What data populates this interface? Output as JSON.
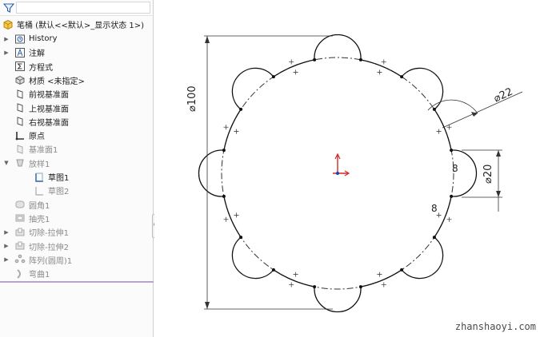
{
  "feature_tree": {
    "root": "笔桶  (默认<<默认>_显示状态 1>)",
    "items": [
      {
        "label": "History",
        "dim": false,
        "expand": "▶"
      },
      {
        "label": "注解",
        "dim": false,
        "expand": "▶"
      },
      {
        "label": "方程式",
        "dim": false,
        "expand": ""
      },
      {
        "label": "材质 <未指定>",
        "dim": false,
        "expand": ""
      },
      {
        "label": "前视基准面",
        "dim": false,
        "expand": ""
      },
      {
        "label": "上视基准面",
        "dim": false,
        "expand": ""
      },
      {
        "label": "右视基准面",
        "dim": false,
        "expand": ""
      },
      {
        "label": "原点",
        "dim": false,
        "expand": ""
      },
      {
        "label": "基准面1",
        "dim": true,
        "expand": ""
      },
      {
        "label": "放样1",
        "dim": true,
        "expand": "▼"
      },
      {
        "label": "草图1",
        "dim": false,
        "expand": ""
      },
      {
        "label": "草图2",
        "dim": true,
        "expand": ""
      },
      {
        "label": "圆角1",
        "dim": true,
        "expand": ""
      },
      {
        "label": "抽壳1",
        "dim": true,
        "expand": ""
      },
      {
        "label": "切除-拉伸1",
        "dim": true,
        "expand": "▶"
      },
      {
        "label": "切除-拉伸2",
        "dim": true,
        "expand": "▶"
      },
      {
        "label": "阵列(圆周)1",
        "dim": true,
        "expand": "▶"
      },
      {
        "label": "弯曲1",
        "dim": true,
        "expand": ""
      }
    ]
  },
  "sketch": {
    "dim_diameter_100": "⌀100",
    "dim_diameter_22": "⌀22",
    "dim_diameter_20": "⌀20",
    "relation_label_1": "8",
    "relation_label_2": "8"
  },
  "watermark": "zhanshaoyi.com",
  "colors": {
    "tree_selection": "#dbe9f8",
    "separator": "#b8a3c9",
    "origin_red": "#d62828",
    "origin_blue": "#1f3fbf"
  }
}
